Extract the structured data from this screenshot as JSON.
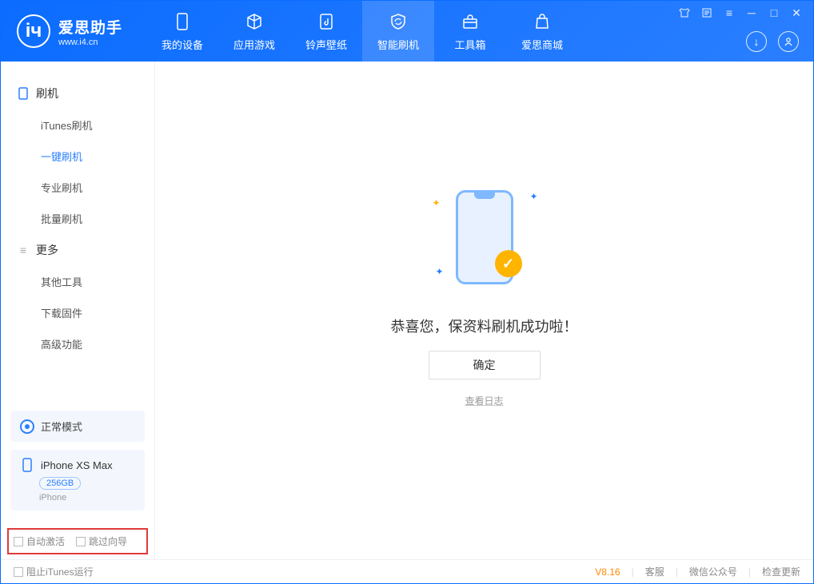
{
  "header": {
    "app_title": "爱思助手",
    "app_url": "www.i4.cn",
    "nav": [
      {
        "label": "我的设备"
      },
      {
        "label": "应用游戏"
      },
      {
        "label": "铃声壁纸"
      },
      {
        "label": "智能刷机"
      },
      {
        "label": "工具箱"
      },
      {
        "label": "爱思商城"
      }
    ]
  },
  "sidebar": {
    "sections": [
      {
        "title": "刷机",
        "items": [
          "iTunes刷机",
          "一键刷机",
          "专业刷机",
          "批量刷机"
        ]
      },
      {
        "title": "更多",
        "items": [
          "其他工具",
          "下载固件",
          "高级功能"
        ]
      }
    ],
    "mode_label": "正常模式",
    "device": {
      "name": "iPhone XS Max",
      "capacity": "256GB",
      "type": "iPhone"
    },
    "options": {
      "auto_activate": "自动激活",
      "skip_guide": "跳过向导"
    }
  },
  "main": {
    "success_message": "恭喜您，保资料刷机成功啦！",
    "ok_button": "确定",
    "view_log": "查看日志"
  },
  "footer": {
    "block_itunes": "阻止iTunes运行",
    "version": "V8.16",
    "links": [
      "客服",
      "微信公众号",
      "检查更新"
    ]
  }
}
